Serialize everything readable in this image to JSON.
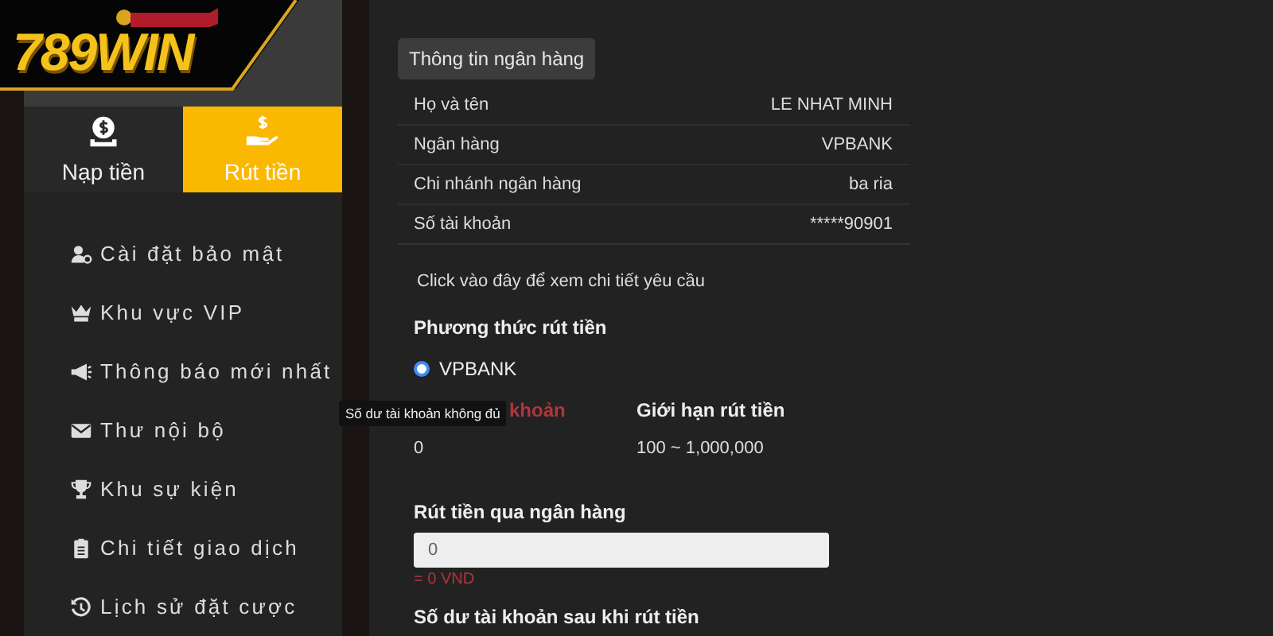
{
  "logo": {
    "text": "789WIN"
  },
  "wallet_tabs": [
    {
      "label": "Nạp tiền",
      "kind": "deposit",
      "selected": false
    },
    {
      "label": "Rút tiền",
      "kind": "withdraw",
      "selected": true
    }
  ],
  "menu": [
    {
      "label": "Cài đặt bảo mật",
      "kind": "security"
    },
    {
      "label": "Khu vực VIP",
      "kind": "vip"
    },
    {
      "label": "Thông báo mới nhất",
      "kind": "news"
    },
    {
      "label": "Thư nội bộ",
      "kind": "mail"
    },
    {
      "label": "Khu sự kiện",
      "kind": "events"
    },
    {
      "label": "Chi tiết giao dịch",
      "kind": "transactions"
    },
    {
      "label": "Lịch sử đặt cược",
      "kind": "history"
    }
  ],
  "bank_info": {
    "title": "Thông tin ngân hàng",
    "rows": [
      {
        "label": "Họ và tên",
        "value": "LE NHAT MINH"
      },
      {
        "label": "Ngân hàng",
        "value": "VPBANK"
      },
      {
        "label": "Chi nhánh ngân hàng",
        "value": "ba ria"
      },
      {
        "label": "Số tài khoản",
        "value": "*****90901"
      }
    ]
  },
  "details_link": "Click vào đây để xem chi tiết yêu cầu",
  "method": {
    "heading": "Phương thức rút tiền",
    "options": [
      {
        "label": "VPBANK",
        "selected": true
      }
    ]
  },
  "balance": {
    "label": "khoản",
    "value": "0",
    "tooltip": "Số dư tài khoản không đủ"
  },
  "limit": {
    "label": "Giới hạn rút tiền",
    "value": "100 ~ 1,000,000"
  },
  "amount": {
    "label": "Rút tiền qua ngân hàng",
    "placeholder": "0",
    "converted": "= 0 VND"
  },
  "after_balance": {
    "label": "Số dư tài khoản sau khi rút tiền"
  }
}
